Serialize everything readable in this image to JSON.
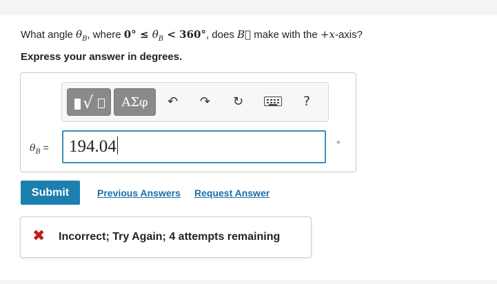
{
  "question": {
    "p1": "What angle ",
    "theta": "θ",
    "sub_b": "B",
    "p2": ", where ",
    "range": "0° ≤ ",
    "range_end": " < 360°",
    "p3": ", does ",
    "vec_b": "B⃗",
    "p4": " make with the ",
    "axis": "+x",
    "p5": "-axis?"
  },
  "instruction": "Express your answer in degrees.",
  "toolbar": {
    "templates_icon": "fraction-sqrt-template-icon",
    "greek_label": "ΑΣφ",
    "undo_icon": "↶",
    "redo_icon": "↷",
    "reset_icon": "↻",
    "keyboard_icon": "keyboard-icon",
    "help_label": "?"
  },
  "answer": {
    "var_theta": "θ",
    "var_sub": "B",
    "equals": " = ",
    "value": "194.04",
    "unit": "°"
  },
  "actions": {
    "submit_label": "Submit",
    "previous_answers_label": "Previous Answers",
    "request_answer_label": "Request Answer"
  },
  "feedback": {
    "icon": "✖",
    "message": "Incorrect; Try Again; 4 attempts remaining",
    "color": "#c01c1c"
  },
  "colors": {
    "accent": "#1b7fb0",
    "link": "#1a6ea8",
    "input_border": "#3a8fb8"
  }
}
